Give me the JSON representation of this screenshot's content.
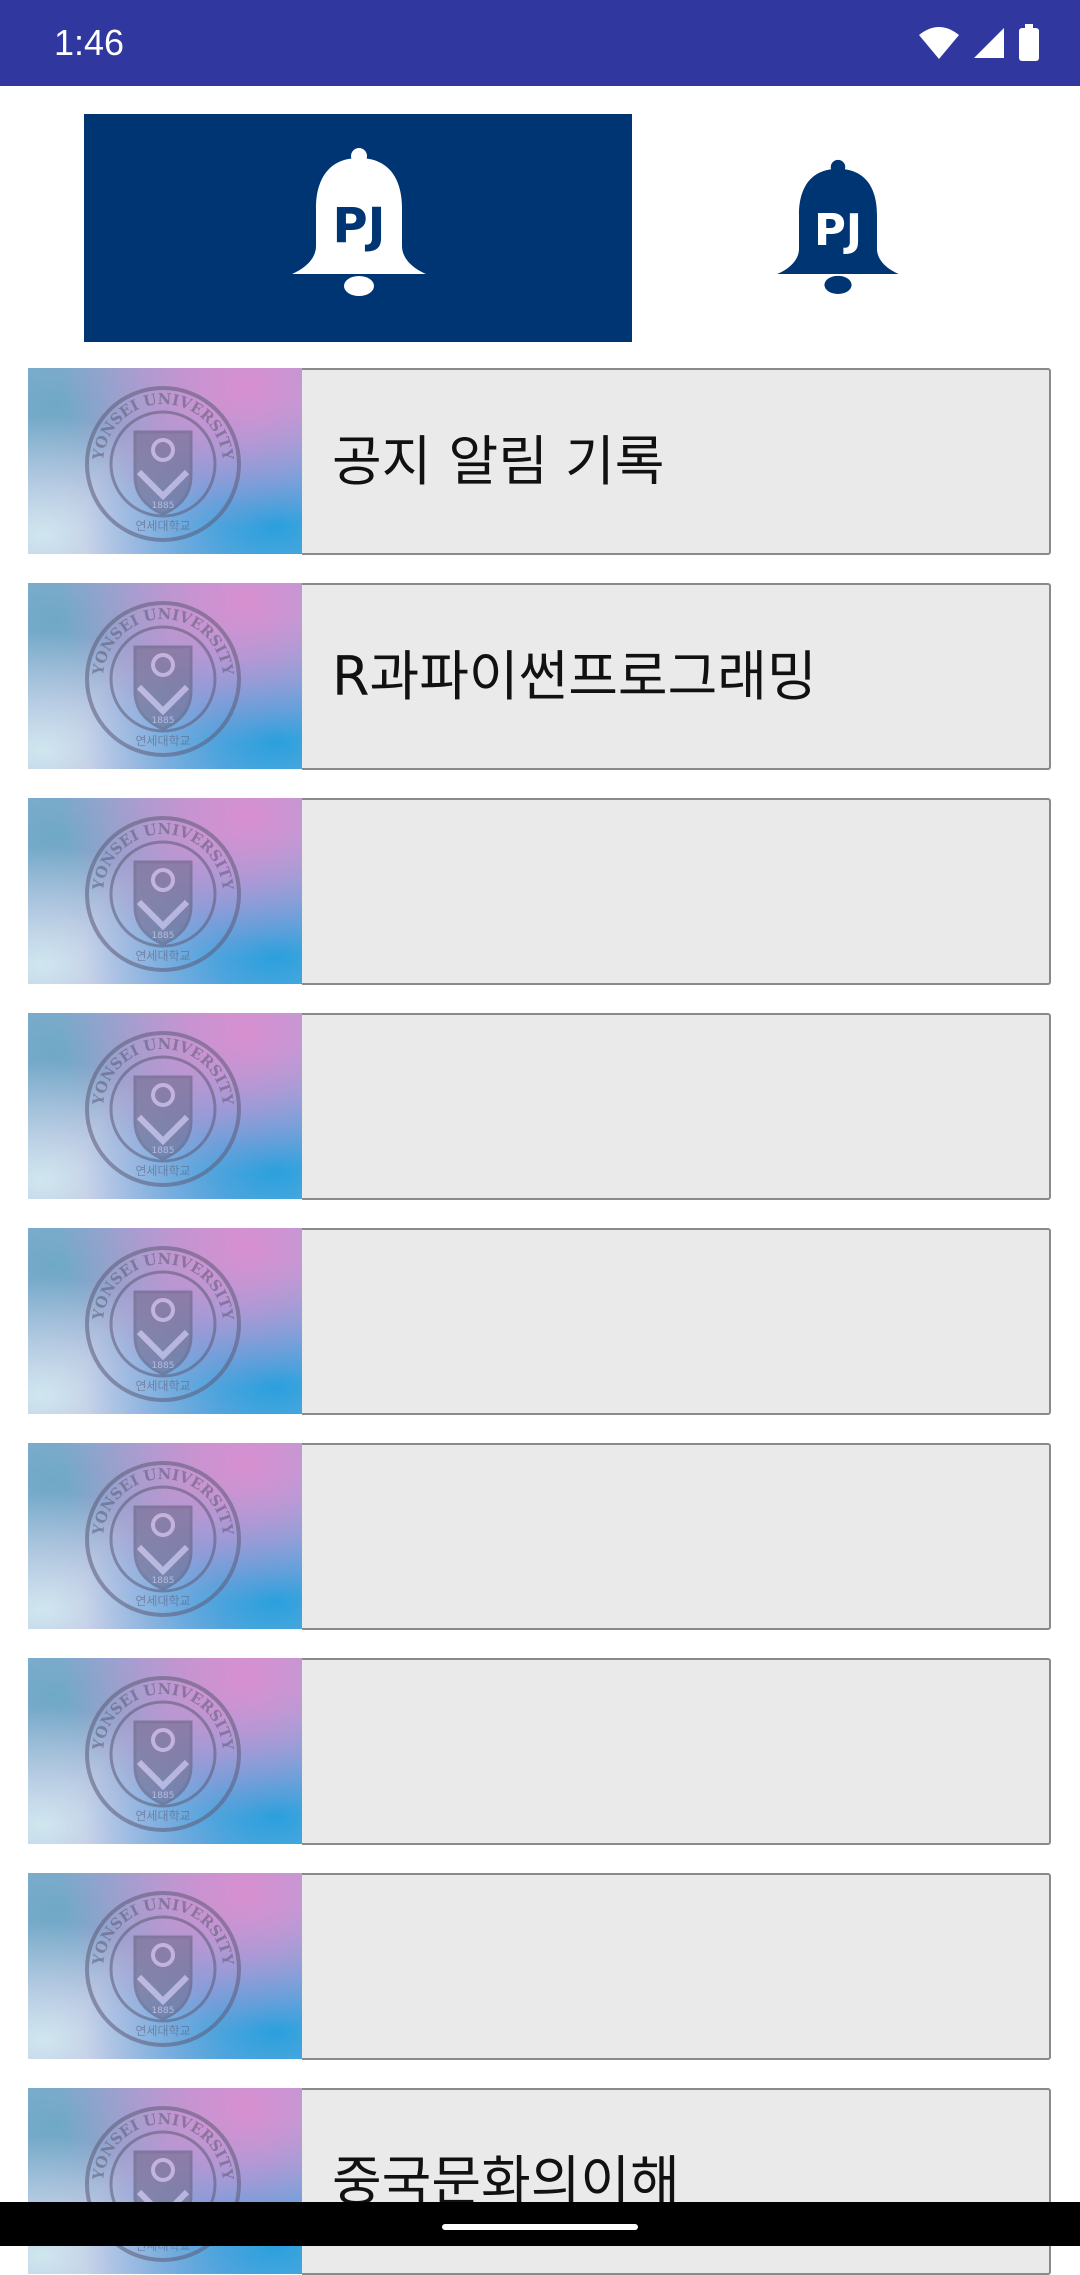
{
  "status_bar": {
    "time": "1:46",
    "icons": [
      "wifi-icon",
      "cell-signal-icon",
      "battery-icon"
    ],
    "background": "#30389f"
  },
  "tabs": [
    {
      "icon": "bell-icon",
      "icon_text": "PJ",
      "active": true
    },
    {
      "icon": "bell-icon",
      "icon_text": "PJ",
      "active": false
    }
  ],
  "colors": {
    "tab_active_bg": "#003573",
    "bell_dark": "#003573",
    "row_bg": "#eaeaea"
  },
  "thumbnail": {
    "icon": "yonsei-university-seal-icon",
    "seal_text": "YONSEI UNIVERSITY",
    "seal_year": "1885",
    "seal_korean": "연세대학교"
  },
  "courses": [
    {
      "title": "공지 알림 기록"
    },
    {
      "title": "R과파이썬프로그래밍"
    },
    {
      "title": ""
    },
    {
      "title": ""
    },
    {
      "title": ""
    },
    {
      "title": ""
    },
    {
      "title": ""
    },
    {
      "title": ""
    },
    {
      "title": "중국문화의이해"
    }
  ]
}
